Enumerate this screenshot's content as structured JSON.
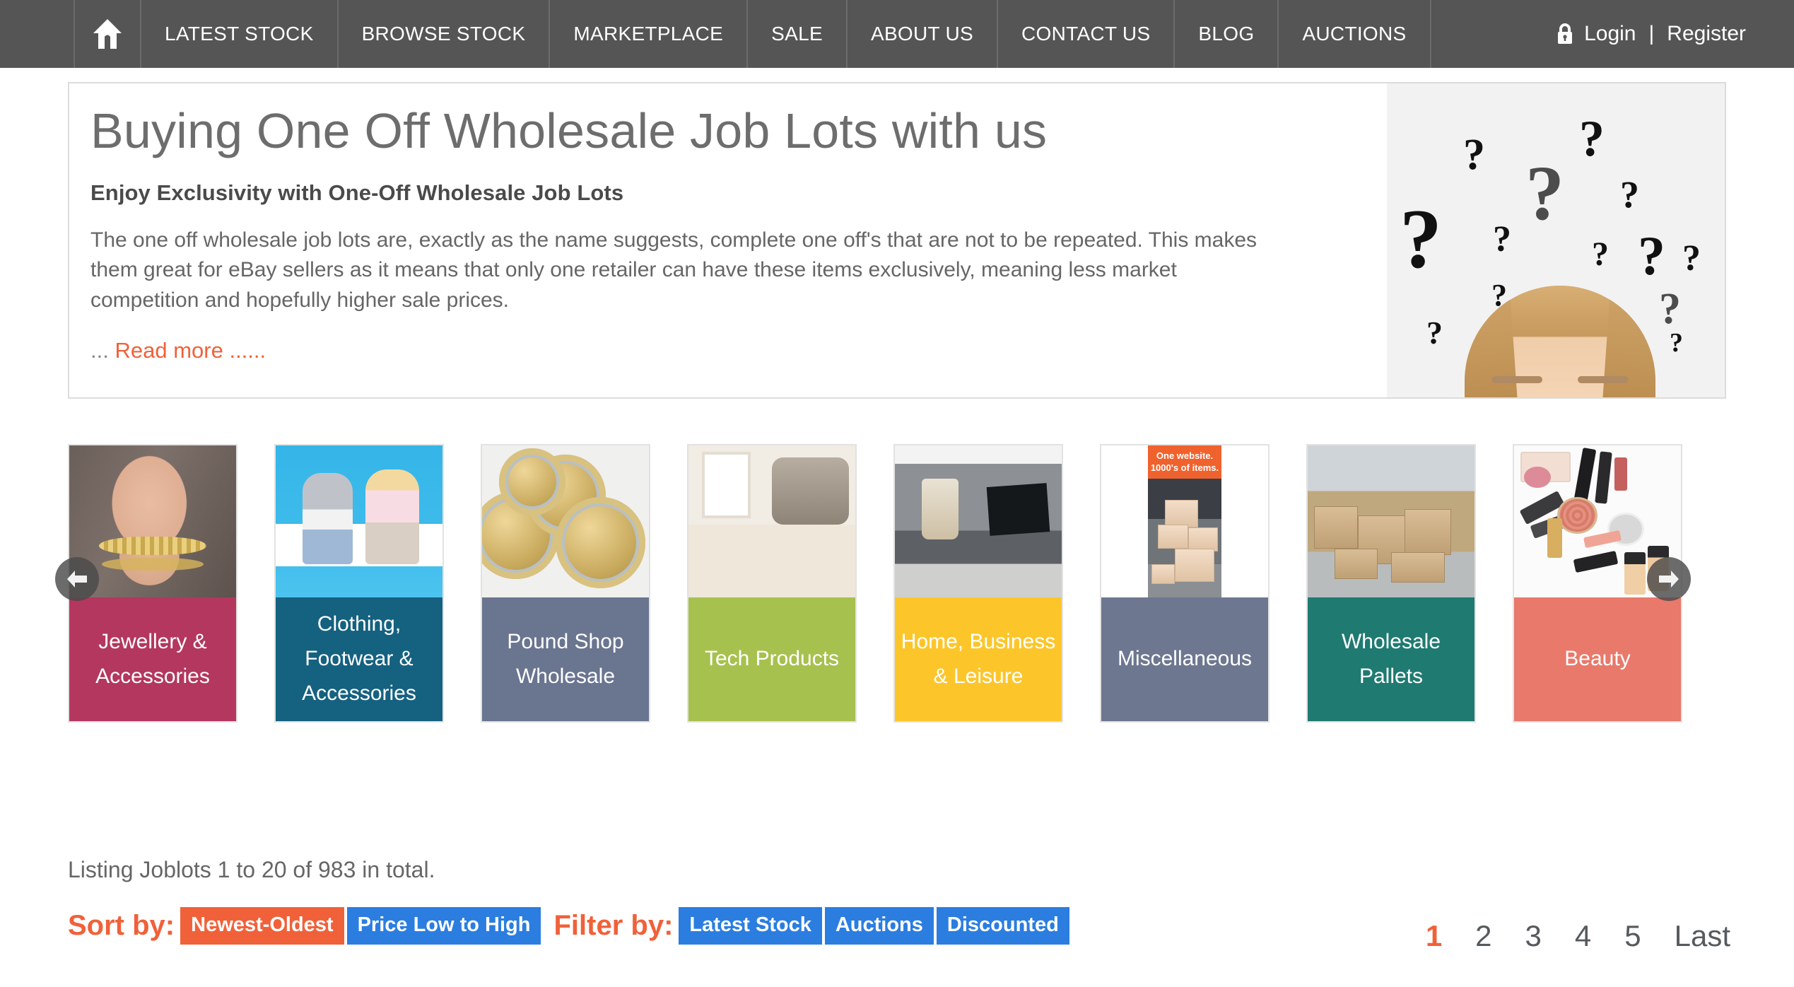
{
  "nav": {
    "home_icon": "home-icon",
    "items": [
      {
        "label": "LATEST STOCK"
      },
      {
        "label": "BROWSE STOCK"
      },
      {
        "label": "MARKETPLACE"
      },
      {
        "label": "SALE"
      },
      {
        "label": "ABOUT US"
      },
      {
        "label": "CONTACT US"
      },
      {
        "label": "BLOG"
      },
      {
        "label": "AUCTIONS"
      }
    ],
    "account": {
      "lock_icon": "lock-icon",
      "login": "Login",
      "separator": "|",
      "register": "Register"
    }
  },
  "hero": {
    "title": "Buying One Off Wholesale Job Lots with us",
    "subtitle": "Enjoy Exclusivity with One-Off Wholesale Job Lots",
    "body": "The one off wholesale job lots are, exactly as the name suggests, complete one off's that are not to be repeated. This makes them great for eBay sellers as it means that only one retailer can have these items exclusively, meaning less market competition and hopefully higher sale prices.",
    "read_more_prefix": "...",
    "read_more": "Read more",
    "read_more_suffix": "......",
    "image_alt": "woman-with-question-marks-photo"
  },
  "carousel": {
    "prev_label": "previous",
    "next_label": "next",
    "cards": [
      {
        "label": "Jewellery & Accessories",
        "color": "#b3375e",
        "thumb": "jewellery-thumb"
      },
      {
        "label": "Clothing, Footwear & Accessories",
        "color": "#156180",
        "thumb": "clothing-thumb"
      },
      {
        "label": "Pound Shop Wholesale",
        "color": "#6a7590",
        "thumb": "pound-coins-thumb"
      },
      {
        "label": "Tech Products",
        "color": "#a7c14e",
        "thumb": "vacuum-thumb"
      },
      {
        "label": "Home, Business & Leisure",
        "color": "#fcc62b",
        "thumb": "home-interior-thumb"
      },
      {
        "label": "Miscellaneous",
        "color": "#6d7790",
        "thumb": "boxes-thumb"
      },
      {
        "label": "Wholesale Pallets",
        "color": "#1f7a71",
        "thumb": "pallets-thumb"
      },
      {
        "label": "Beauty",
        "color": "#e8796b",
        "thumb": "makeup-thumb"
      }
    ],
    "misc_banner_line1": "One website.",
    "misc_banner_line2": "1000's of items."
  },
  "listing": {
    "summary": "Listing Joblots 1 to 20 of 983 in total.",
    "sort_label": "Sort by:",
    "sort_options": [
      {
        "label": "Newest-Oldest",
        "style": "orange"
      },
      {
        "label": "Price Low to High",
        "style": "blue"
      }
    ],
    "filter_label": "Filter by:",
    "filter_options": [
      {
        "label": "Latest Stock",
        "style": "blue"
      },
      {
        "label": "Auctions",
        "style": "blue"
      },
      {
        "label": "Discounted",
        "style": "blue"
      }
    ]
  },
  "pagination": {
    "pages": [
      {
        "label": "1",
        "active": true
      },
      {
        "label": "2",
        "active": false
      },
      {
        "label": "3",
        "active": false
      },
      {
        "label": "4",
        "active": false
      },
      {
        "label": "5",
        "active": false
      },
      {
        "label": "Last",
        "active": false
      }
    ]
  },
  "colors": {
    "nav_bg": "#555555",
    "accent_orange": "#f0613a",
    "accent_blue": "#2b7de0",
    "text_grey": "#666666"
  }
}
